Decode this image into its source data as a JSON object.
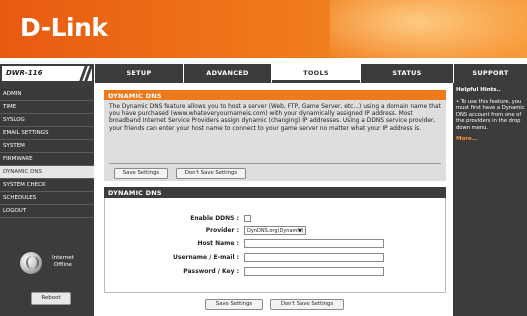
{
  "brand": {
    "logo": "D-Link"
  },
  "model": "DWR-116",
  "tabs": [
    {
      "label": "SETUP"
    },
    {
      "label": "ADVANCED"
    },
    {
      "label": "TOOLS"
    },
    {
      "label": "STATUS"
    },
    {
      "label": "SUPPORT"
    }
  ],
  "active_tab": "TOOLS",
  "sidebar": {
    "items": [
      {
        "label": "ADMIN"
      },
      {
        "label": "TIME"
      },
      {
        "label": "SYSLOG"
      },
      {
        "label": "EMAIL SETTINGS"
      },
      {
        "label": "SYSTEM"
      },
      {
        "label": "FIRMWARE"
      },
      {
        "label": "DYNAMIC DNS"
      },
      {
        "label": "SYSTEM CHECK"
      },
      {
        "label": "SCHEDULES"
      },
      {
        "label": "LOGOUT"
      }
    ],
    "active_item": "DYNAMIC DNS",
    "internet_status_line1": "Internet",
    "internet_status_line2": "Offline",
    "reboot_label": "Reboot"
  },
  "intro": {
    "title": "DYNAMIC DNS",
    "text": "The Dynamic DNS feature allows you to host a server (Web, FTP, Game Server, etc...) using a domain name that you have purchased (www.whateveryournameis.com) with your dynamically assigned IP address. Most broadband Internet Service Providers assign dynamic (changing) IP addresses. Using a DDNS service provider, your friends can enter your host name to connect to your game server no matter what your IP address is.",
    "save_label": "Save Settings",
    "dont_save_label": "Don't Save Settings"
  },
  "ddns": {
    "title": "DYNAMIC DNS",
    "enable_label": "Enable DDNS :",
    "enable_checked": false,
    "provider_label": "Provider :",
    "provider_value": "DynDNS.org(Dynamic)",
    "host_label": "Host Name :",
    "host_value": "",
    "username_label": "Username / E-mail :",
    "username_value": "",
    "password_label": "Password / Key :",
    "password_value": "",
    "save_label": "Save Settings",
    "dont_save_label": "Don't Save Settings"
  },
  "help": {
    "title": "Helpful Hints..",
    "text": "• To use this feature, you must first have a Dynamic DNS account from one of the providers in the drop down menu.",
    "more": "More..."
  },
  "colors": {
    "brand_orange": "#f07a1a",
    "nav_dark": "#3c3c3c",
    "panel_gray": "#dedede"
  }
}
